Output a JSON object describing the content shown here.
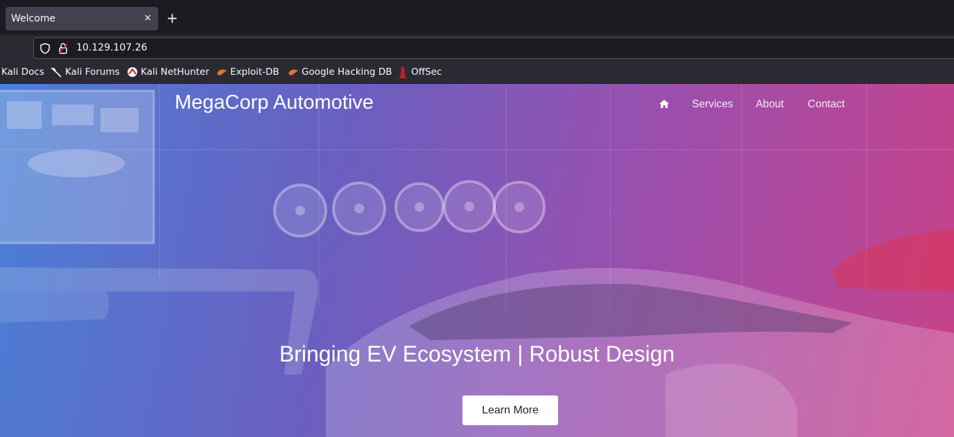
{
  "browser": {
    "tab": {
      "title": "Welcome",
      "close_glyph": "×"
    },
    "new_tab_glyph": "+",
    "url": "10.129.107.26",
    "bookmarks": [
      {
        "label": "Kali Docs",
        "icon": ""
      },
      {
        "label": "Kali Forums",
        "icon": "kali-dragon-icon"
      },
      {
        "label": "Kali NetHunter",
        "icon": "nethunter-icon"
      },
      {
        "label": "Exploit-DB",
        "icon": "exploit-db-icon"
      },
      {
        "label": "Google Hacking DB",
        "icon": "ghdb-icon"
      },
      {
        "label": "OffSec",
        "icon": "offsec-icon"
      }
    ]
  },
  "site": {
    "brand": "MegaCorp Automotive",
    "nav": {
      "home_icon": "home-icon",
      "links": [
        "Services",
        "About",
        "Contact"
      ]
    },
    "hero": {
      "tagline": "Bringing EV Ecosystem | Robust Design",
      "cta": "Learn More"
    }
  },
  "colors": {
    "chrome_dark": "#1c1b22",
    "chrome_toolbar": "#2b2a33",
    "gradient_start": "#4a7fd6",
    "gradient_end": "#c8428a"
  }
}
